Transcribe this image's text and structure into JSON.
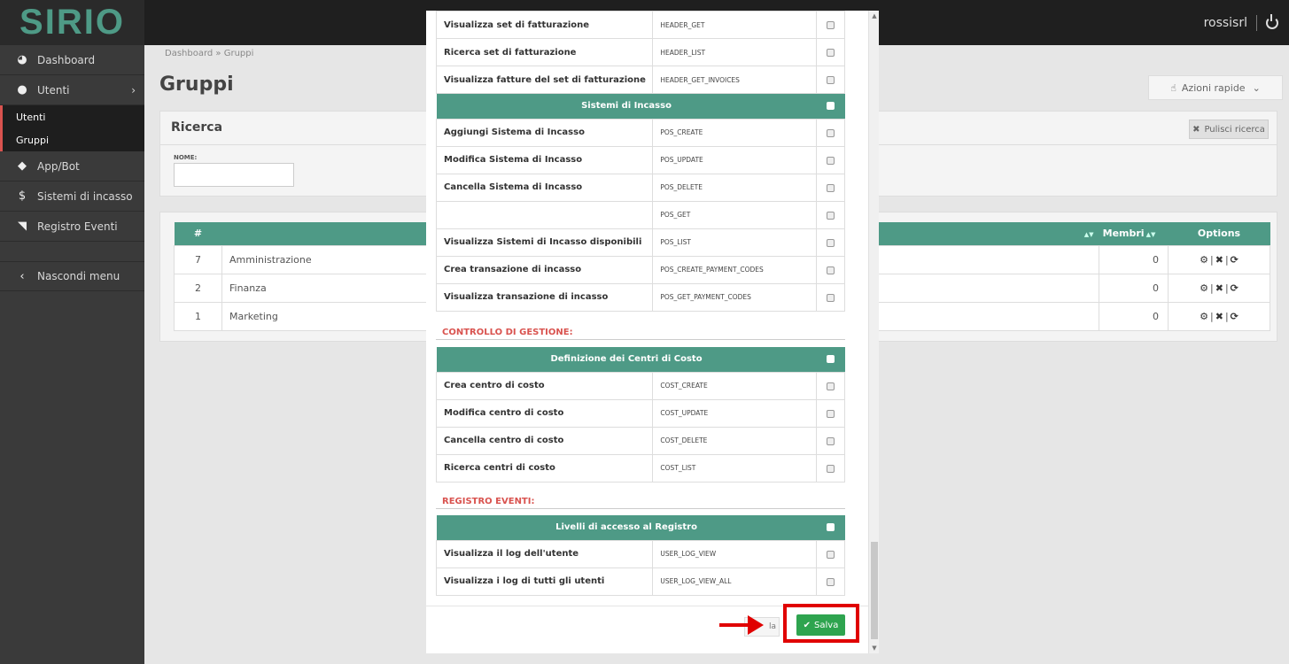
{
  "app": {
    "logo": "SIRIO",
    "user": "rossisrl"
  },
  "sidebar": {
    "items": [
      {
        "label": "Dashboard",
        "icon": "dashboard-icon"
      },
      {
        "label": "Utenti",
        "icon": "user-icon"
      }
    ],
    "subitems": [
      {
        "label": "Utenti"
      },
      {
        "label": "Gruppi"
      }
    ],
    "items2": [
      {
        "label": "App/Bot",
        "icon": "android-icon"
      },
      {
        "label": "Sistemi di incasso",
        "icon": "dollar-icon"
      },
      {
        "label": "Registro Eventi",
        "icon": "rss-icon"
      }
    ],
    "hide_label": "Nascondi menu"
  },
  "main": {
    "breadcrumb": "Dashboard » Gruppi",
    "title": "Gruppi",
    "quick_actions": "Azioni rapide",
    "search": {
      "title": "Ricerca",
      "clear_label": "Pulisci ricerca",
      "name_label": "NOME:",
      "name_value": ""
    },
    "table": {
      "headers": {
        "hash": "#",
        "members": "Membri",
        "options": "Options"
      },
      "rows": [
        {
          "id": "7",
          "name": "Amministrazione",
          "members": "0"
        },
        {
          "id": "2",
          "name": "Finanza",
          "members": "0"
        },
        {
          "id": "1",
          "name": "Marketing",
          "members": "0"
        }
      ]
    }
  },
  "modal": {
    "fatturazione_rows": [
      {
        "desc": "Visualizza set di fatturazione",
        "code": "HEADER_GET"
      },
      {
        "desc": "Ricerca set di fatturazione",
        "code": "HEADER_LIST"
      },
      {
        "desc": "Visualizza fatture del set di fatturazione",
        "code": "HEADER_GET_INVOICES"
      }
    ],
    "incasso": {
      "header": "Sistemi di Incasso",
      "rows": [
        {
          "desc": "Aggiungi Sistema di Incasso",
          "code": "POS_CREATE"
        },
        {
          "desc": "Modifica Sistema di Incasso",
          "code": "POS_UPDATE"
        },
        {
          "desc": "Cancella Sistema di Incasso",
          "code": "POS_DELETE"
        },
        {
          "desc": "",
          "code": "POS_GET"
        },
        {
          "desc": "Visualizza Sistemi di Incasso disponibili",
          "code": "POS_LIST"
        },
        {
          "desc": "Crea transazione di incasso",
          "code": "POS_CREATE_PAYMENT_CODES"
        },
        {
          "desc": "Visualizza transazione di incasso",
          "code": "POS_GET_PAYMENT_CODES"
        }
      ]
    },
    "controllo": {
      "section": "CONTROLLO DI GESTIONE:",
      "header": "Definizione dei Centri di Costo",
      "rows": [
        {
          "desc": "Crea centro di costo",
          "code": "COST_CREATE"
        },
        {
          "desc": "Modifica centro di costo",
          "code": "COST_UPDATE"
        },
        {
          "desc": "Cancella centro di costo",
          "code": "COST_DELETE"
        },
        {
          "desc": "Ricerca centri di costo",
          "code": "COST_LIST"
        }
      ]
    },
    "registro": {
      "section": "REGISTRO EVENTI:",
      "header": "Livelli di accesso al Registro",
      "rows": [
        {
          "desc": "Visualizza il log dell'utente",
          "code": "USER_LOG_VIEW"
        },
        {
          "desc": "Visualizza i log di tutti gli utenti",
          "code": "USER_LOG_VIEW_ALL"
        }
      ]
    },
    "footer": {
      "cancel_label": "la",
      "save_label": "Salva"
    }
  },
  "colors": {
    "accent": "#4e9a86",
    "danger": "#d9534f",
    "save": "#2ea44f",
    "highlight": "#e00000"
  }
}
